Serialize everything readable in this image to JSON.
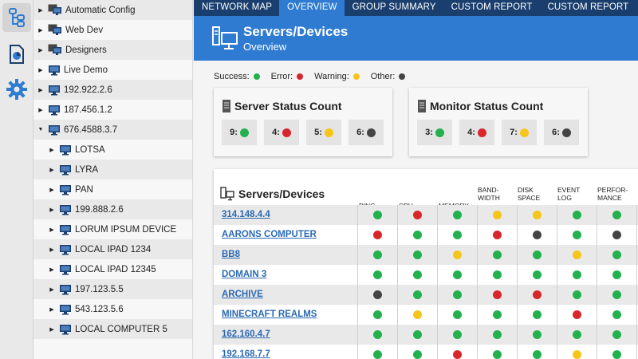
{
  "tree": {
    "items": [
      {
        "label": "Automatic Config",
        "depth": 0,
        "expanded": false,
        "icon": "group-icon"
      },
      {
        "label": "Web Dev",
        "depth": 0,
        "expanded": false,
        "icon": "group-icon"
      },
      {
        "label": "Designers",
        "depth": 0,
        "expanded": false,
        "icon": "group-icon"
      },
      {
        "label": "Live Demo",
        "depth": 0,
        "expanded": false,
        "icon": "monitor-icon"
      },
      {
        "label": "192.922.2.6",
        "depth": 0,
        "expanded": false,
        "icon": "monitor-icon"
      },
      {
        "label": "187.456.1.2",
        "depth": 0,
        "expanded": false,
        "icon": "monitor-icon"
      },
      {
        "label": "676.4588.3.7",
        "depth": 0,
        "expanded": true,
        "icon": "monitor-icon"
      },
      {
        "label": "LOTSA",
        "depth": 1,
        "expanded": false,
        "icon": "monitor-icon"
      },
      {
        "label": "LYRA",
        "depth": 1,
        "expanded": false,
        "icon": "monitor-icon"
      },
      {
        "label": "PAN",
        "depth": 1,
        "expanded": false,
        "icon": "monitor-icon"
      },
      {
        "label": "199.888.2.6",
        "depth": 1,
        "expanded": false,
        "icon": "monitor-icon"
      },
      {
        "label": "LORUM IPSUM DEVICE",
        "depth": 1,
        "expanded": false,
        "icon": "monitor-icon"
      },
      {
        "label": "LOCAL IPAD 1234",
        "depth": 1,
        "expanded": false,
        "icon": "monitor-icon"
      },
      {
        "label": "LOCAL IPAD 12345",
        "depth": 1,
        "expanded": false,
        "icon": "monitor-icon"
      },
      {
        "label": "197.123.5.5",
        "depth": 1,
        "expanded": false,
        "icon": "monitor-icon"
      },
      {
        "label": "543.123.5.6",
        "depth": 1,
        "expanded": false,
        "icon": "monitor-icon"
      },
      {
        "label": "LOCAL COMPUTER 5",
        "depth": 1,
        "expanded": false,
        "icon": "monitor-icon"
      }
    ]
  },
  "nav": {
    "tabs": [
      "NETWORK MAP",
      "OVERVIEW",
      "GROUP SUMMARY",
      "CUSTOM REPORT",
      "CUSTOM REPORT"
    ],
    "active": 1
  },
  "banner": {
    "title": "Servers/Devices",
    "subtitle": "Overview"
  },
  "legend": {
    "success": "Success:",
    "error": "Error:",
    "warning": "Warning:",
    "other": "Other:"
  },
  "server_status": {
    "title": "Server Status Count",
    "counts": [
      {
        "label": "9:",
        "status": "success"
      },
      {
        "label": "4:",
        "status": "error"
      },
      {
        "label": "5:",
        "status": "warning"
      },
      {
        "label": "6:",
        "status": "other"
      }
    ]
  },
  "monitor_status": {
    "title": "Monitor Status Count",
    "counts": [
      {
        "label": "3:",
        "status": "success"
      },
      {
        "label": "4:",
        "status": "error"
      },
      {
        "label": "7:",
        "status": "warning"
      },
      {
        "label": "6:",
        "status": "other"
      }
    ]
  },
  "table": {
    "title": "Servers/Devices",
    "columns": [
      "PING",
      "CPU",
      "MEMORY",
      "BAND-\nWIDTH",
      "DISK\nSPACE",
      "EVENT\nLOG",
      "PERFOR-\nMANCE"
    ],
    "rows": [
      {
        "name": "314.148.4.4",
        "status": [
          "g",
          "r",
          "g",
          "y",
          "y",
          "g",
          "g"
        ]
      },
      {
        "name": "AARONS COMPUTER",
        "status": [
          "r",
          "g",
          "g",
          "r",
          "k",
          "g",
          "k"
        ]
      },
      {
        "name": "BB8",
        "status": [
          "g",
          "g",
          "y",
          "g",
          "g",
          "y",
          "g"
        ]
      },
      {
        "name": "DOMAIN 3",
        "status": [
          "g",
          "g",
          "g",
          "g",
          "g",
          "g",
          "g"
        ]
      },
      {
        "name": "ARCHIVE",
        "status": [
          "k",
          "g",
          "g",
          "r",
          "r",
          "g",
          "g"
        ]
      },
      {
        "name": "MINECRAFT REALMS",
        "status": [
          "g",
          "y",
          "g",
          "g",
          "g",
          "r",
          "g"
        ]
      },
      {
        "name": "162.160.4.7",
        "status": [
          "g",
          "g",
          "g",
          "g",
          "g",
          "g",
          "g"
        ]
      },
      {
        "name": "192.168.7.7",
        "status": [
          "g",
          "g",
          "r",
          "g",
          "g",
          "y",
          "g"
        ]
      }
    ]
  },
  "colors": {
    "success": "#22b14c",
    "error": "#d9262b",
    "warning": "#f6c51b",
    "other": "#444444",
    "nav_bg": "#1a3f6e",
    "accent": "#2f7bd1",
    "link": "#2a69b3"
  }
}
